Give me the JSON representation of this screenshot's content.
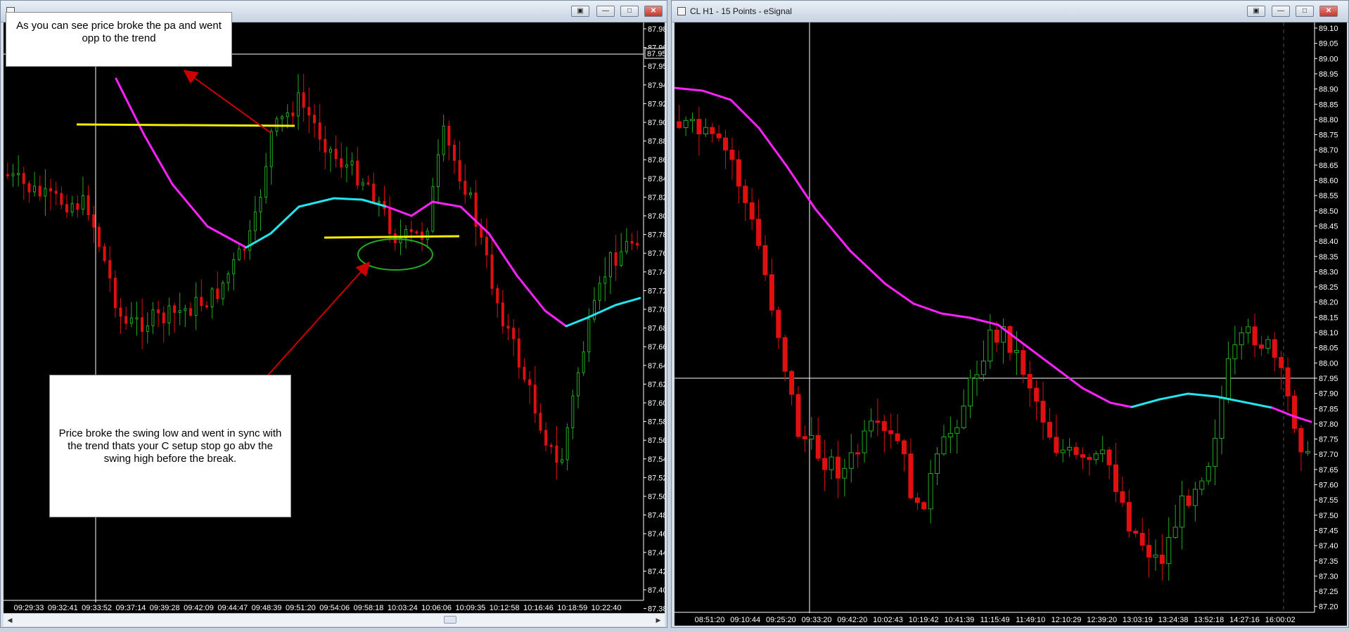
{
  "left_window": {
    "title": "",
    "controls": {
      "restore_all": "▣",
      "minimize": "—",
      "maximize": "□",
      "close": "✕"
    },
    "y_axis_labels": [
      "87.98",
      "87.96",
      "87.95",
      "87.94",
      "87.92",
      "87.90",
      "87.88",
      "87.86",
      "87.84",
      "87.82",
      "87.80",
      "87.78",
      "87.76",
      "87.74",
      "87.72",
      "87.70",
      "87.68",
      "87.66",
      "87.64",
      "87.62",
      "87.60",
      "87.58",
      "87.56",
      "87.54",
      "87.52",
      "87.50",
      "87.48",
      "87.46",
      "87.44",
      "87.42",
      "87.40",
      "87.38"
    ],
    "current_price_label": "87.95",
    "x_axis_labels": [
      "09:29:33",
      "09:32:41",
      "09:33:52",
      "09:37:14",
      "09:39:28",
      "09:42:09",
      "09:44:47",
      "09:48:39",
      "09:51:20",
      "09:54:06",
      "09:58:18",
      "10:03:24",
      "10:06:06",
      "10:09:35",
      "10:12:58",
      "10:16:46",
      "10:18:59",
      "10:22:40"
    ],
    "annotation_top": "As you can see price broke the pa and went opp to the trend",
    "annotation_bottom": "Price broke the swing low and went in sync with the trend  thats your C setup stop go abv the swing high before the break."
  },
  "right_window": {
    "title": "CL H1 - 15 Points - eSignal",
    "controls": {
      "restore_all": "▣",
      "minimize": "—",
      "maximize": "□",
      "close": "✕"
    },
    "y_axis_labels": [
      "89.10",
      "89.05",
      "89.00",
      "88.95",
      "88.90",
      "88.85",
      "88.80",
      "88.75",
      "88.70",
      "88.65",
      "88.60",
      "88.55",
      "88.50",
      "88.45",
      "88.40",
      "88.35",
      "88.30",
      "88.25",
      "88.20",
      "88.15",
      "88.10",
      "88.05",
      "88.00",
      "87.95",
      "87.90",
      "87.85",
      "87.80",
      "87.75",
      "87.70",
      "87.65",
      "87.60",
      "87.55",
      "87.50",
      "87.45",
      "87.40",
      "87.35",
      "87.30",
      "87.25",
      "87.20"
    ],
    "x_axis_labels": [
      "08:51:20",
      "09:10:44",
      "09:25:20",
      "09:33:20",
      "09:42:20",
      "10:02:43",
      "10:19:42",
      "10:41:39",
      "11:15:49",
      "11:49:10",
      "12:10:29",
      "12:39:20",
      "13:03:19",
      "13:24:38",
      "13:52:18",
      "14:27:16",
      "16:00:02"
    ]
  },
  "colors": {
    "chart_bg": "#000000",
    "bull": "#22aa22",
    "bear": "#e01010",
    "ma_down": "#ff22ff",
    "ma_up": "#22e5ee",
    "annotation_line": "#f2ee00",
    "arrow": "#cc0000",
    "circle": "#22aa22"
  }
}
